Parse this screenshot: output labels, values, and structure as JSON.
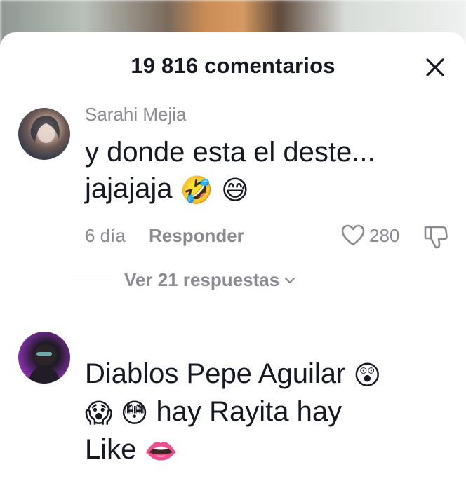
{
  "header": {
    "title": "19 816 comentarios"
  },
  "comments": [
    {
      "username": "Sarahi Mejia",
      "text": "y donde esta el deste... jajajaja",
      "emojis": [
        "🤣",
        "😅"
      ],
      "date": "6 día",
      "reply_label": "Responder",
      "like_count": "280",
      "view_replies_label": "Ver 21 respuestas"
    },
    {
      "text_line1": "Diablos Pepe Aguilar",
      "emoji_1": "😲",
      "emoji_2": "😱",
      "emoji_3": "😳",
      "text_line2": "hay Rayita hay",
      "text_line3": "Like",
      "emoji_4": "👄"
    }
  ],
  "colors": {
    "text_primary": "#161823",
    "text_secondary": "#8a8b91",
    "background": "#ffffff"
  },
  "icons": {
    "close": "close-icon",
    "like": "heart-outline-icon",
    "dislike": "thumbs-down-icon",
    "expand": "chevron-down-icon"
  }
}
